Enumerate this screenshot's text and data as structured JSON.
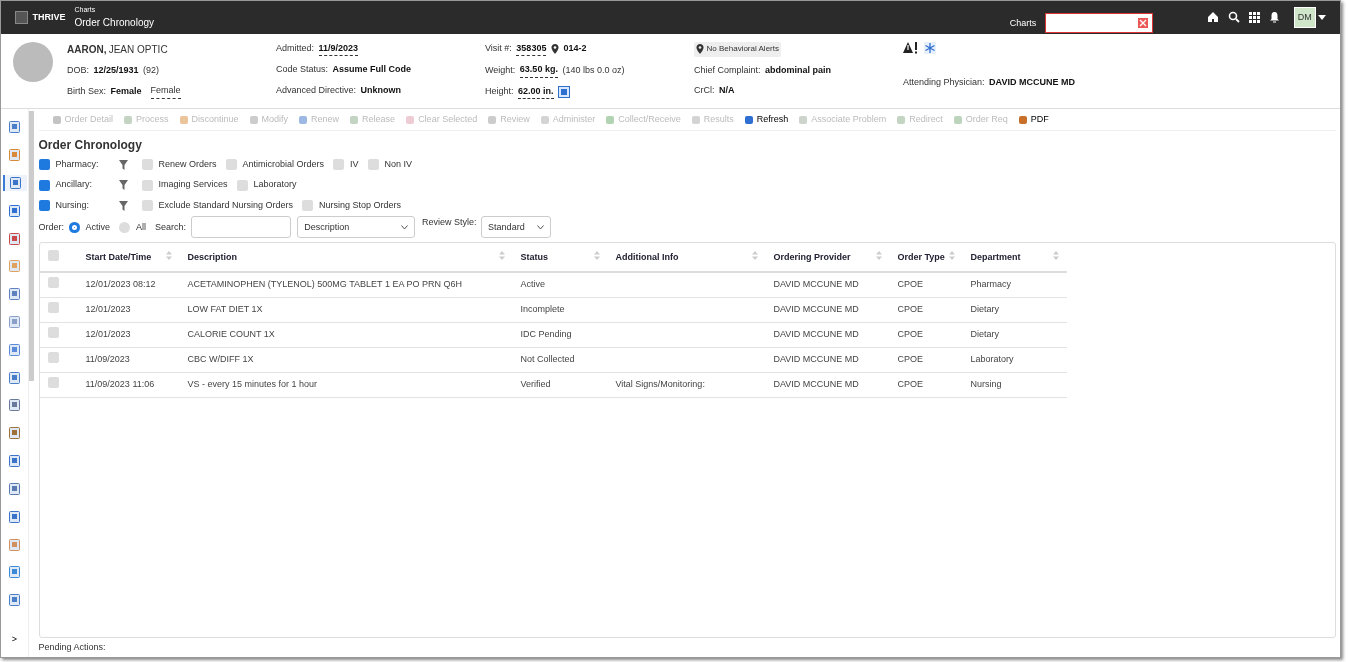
{
  "app": {
    "brand": "THRIVE",
    "section": "Charts",
    "page": "Order Chronology"
  },
  "topbar": {
    "charts_link": "Charts",
    "user_initials": "DM"
  },
  "patient": {
    "name_last": "AARON,",
    "name_first": "JEAN OPTIC",
    "fields": [
      {
        "label": "DOB:",
        "value": "12/25/1931",
        "extra": "(92)"
      },
      {
        "label": "Birth Sex:",
        "value": "Female",
        "extra": "Female"
      },
      {
        "label": "Admitted:",
        "value": "11/9/2023"
      },
      {
        "label": "Code Status:",
        "value": "Assume Full Code"
      },
      {
        "label": "Advanced Directive:",
        "value": "Unknown"
      },
      {
        "label": "Visit #:",
        "value": "358305",
        "extra": "014-2"
      },
      {
        "label": "Weight:",
        "value": "63.50 kg.",
        "extra": "(140 lbs 0.0 oz)"
      },
      {
        "label": "Height:",
        "value": "62.00 in."
      },
      {
        "label": "Chief Complaint:",
        "value": "abdominal pain"
      },
      {
        "label": "CrCl:",
        "value": "N/A"
      },
      {
        "label": "Attending Physician:",
        "value": "DAVID MCCUNE MD"
      }
    ],
    "behavioral_alert": "No Behavioral Alerts"
  },
  "sidebar": {
    "items": [
      {
        "selected": false
      },
      {
        "selected": false
      },
      {
        "selected": true
      },
      {
        "selected": false
      },
      {
        "selected": false
      },
      {
        "selected": false
      },
      {
        "selected": false
      },
      {
        "selected": false
      },
      {
        "selected": false
      },
      {
        "selected": false
      },
      {
        "selected": false
      },
      {
        "selected": false
      },
      {
        "selected": false
      },
      {
        "selected": false
      },
      {
        "selected": false
      },
      {
        "selected": false
      },
      {
        "selected": false
      },
      {
        "selected": false
      }
    ],
    "expand": ">"
  },
  "toolbar": [
    {
      "label": "Order Detail",
      "disabled": true
    },
    {
      "label": "Process",
      "disabled": true
    },
    {
      "label": "Discontinue",
      "disabled": true
    },
    {
      "label": "Modify",
      "disabled": true
    },
    {
      "label": "Renew",
      "disabled": true
    },
    {
      "label": "Release",
      "disabled": true
    },
    {
      "label": "Clear Selected",
      "disabled": true
    },
    {
      "label": "Review",
      "disabled": true
    },
    {
      "label": "Administer",
      "disabled": true
    },
    {
      "label": "Collect/Receive",
      "disabled": true
    },
    {
      "label": "Results",
      "disabled": true
    },
    {
      "label": "Refresh",
      "disabled": false
    },
    {
      "label": "Associate Problem",
      "disabled": true
    },
    {
      "label": "Redirect",
      "disabled": true
    },
    {
      "label": "Order Req",
      "disabled": true
    },
    {
      "label": "PDF",
      "disabled": false
    }
  ],
  "title": "Order Chronology",
  "filters": [
    {
      "label": "Pharmacy:",
      "checked": true,
      "options": [
        {
          "label": "Renew Orders",
          "checked": false
        },
        {
          "label": "Antimicrobial Orders",
          "checked": false
        },
        {
          "label": "IV",
          "checked": false
        },
        {
          "label": "Non IV",
          "checked": false
        }
      ]
    },
    {
      "label": "Ancillary:",
      "checked": true,
      "options": [
        {
          "label": "Imaging Services",
          "checked": false
        },
        {
          "label": "Laboratory",
          "checked": false
        }
      ]
    },
    {
      "label": "Nursing:",
      "checked": true,
      "options": [
        {
          "label": "Exclude Standard Nursing Orders",
          "checked": false
        },
        {
          "label": "Nursing Stop Orders",
          "checked": false
        }
      ]
    }
  ],
  "order_filter": {
    "label": "Order:",
    "options": [
      {
        "label": "Active",
        "selected": true
      },
      {
        "label": "All",
        "selected": false
      }
    ],
    "search_label": "Search:",
    "search_by": "Description",
    "review_style_label": "Review Style:",
    "review_style": "Standard"
  },
  "table": {
    "select_all_checked": false,
    "columns": [
      "Start Date/Time",
      "Description",
      "Status",
      "Additional Info",
      "Ordering Provider",
      "Order Type",
      "Department"
    ],
    "rows": [
      {
        "selected": false,
        "cells": [
          "12/01/2023 08:12",
          "ACETAMINOPHEN (TYLENOL) 500MG TABLET 1 EA PO PRN Q6H",
          "Active",
          "",
          "DAVID MCCUNE MD",
          "CPOE",
          "Pharmacy"
        ]
      },
      {
        "selected": false,
        "cells": [
          "12/01/2023",
          "LOW FAT DIET 1X",
          "Incomplete",
          "",
          "DAVID MCCUNE MD",
          "CPOE",
          "Dietary"
        ]
      },
      {
        "selected": false,
        "cells": [
          "12/01/2023",
          "CALORIE COUNT 1X",
          "IDC Pending",
          "",
          "DAVID MCCUNE MD",
          "CPOE",
          "Dietary"
        ]
      },
      {
        "selected": false,
        "cells": [
          "11/09/2023",
          "CBC W/DIFF 1X",
          "Not Collected",
          "",
          "DAVID MCCUNE MD",
          "CPOE",
          "Laboratory"
        ]
      },
      {
        "selected": false,
        "cells": [
          "11/09/2023 11:06",
          "VS - every 15 minutes for 1 hour",
          "Verified",
          "Vital Signs/Monitoring:",
          "DAVID MCCUNE MD",
          "CPOE",
          "Nursing"
        ]
      }
    ]
  },
  "footer": "Pending Actions:"
}
